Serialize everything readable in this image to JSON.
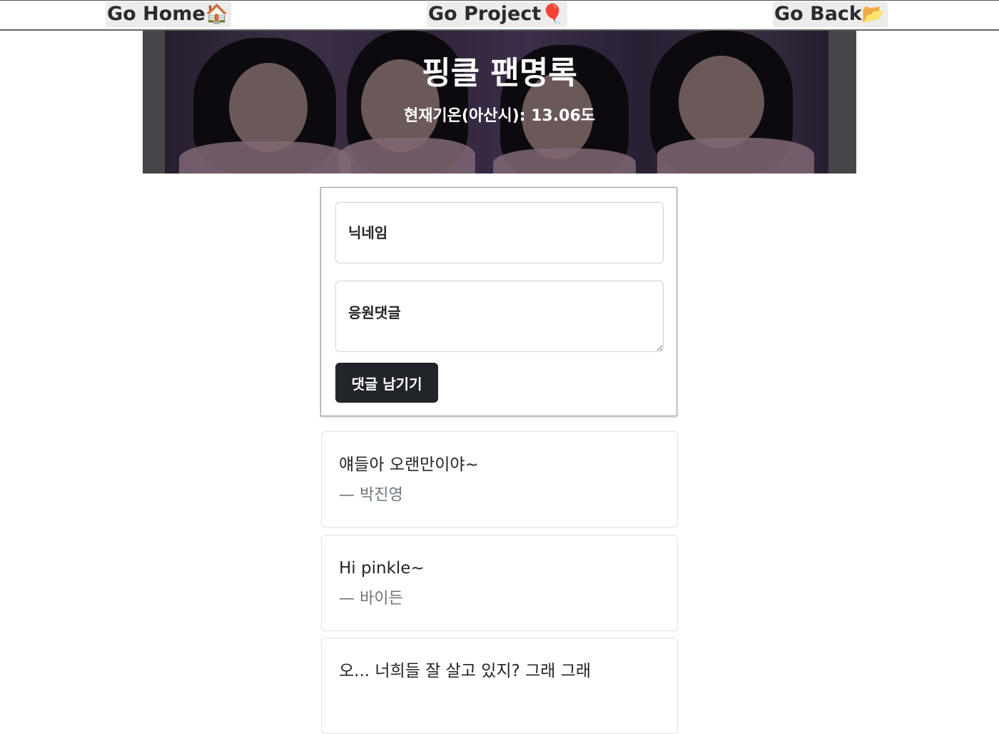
{
  "nav": {
    "home_label": "Go Home",
    "home_icon": "house-icon",
    "home_emoji": "🏠",
    "project_label": "Go Project",
    "project_icon": "balloon-icon",
    "project_emoji": "🎈",
    "back_label": "Go Back",
    "back_icon": "folder-icon",
    "back_emoji": "📂"
  },
  "banner": {
    "title": "핑클 팬명록",
    "temperature": "현재기온(아산시): 13.06도"
  },
  "form": {
    "nickname_placeholder": "닉네임",
    "comment_placeholder": "응원댓글",
    "submit_label": "댓글 남기기"
  },
  "comments": [
    {
      "text": "얘들아 오랜만이야~",
      "author": "— 박진영"
    },
    {
      "text": "Hi pinkle~",
      "author": "— 바이든"
    },
    {
      "text": "오... 너희들 잘 살고 있지? 그래 그래",
      "author": ""
    }
  ],
  "colors": {
    "button_bg": "#212529",
    "author_text": "#6c757d",
    "card_border": "#dee2e6"
  }
}
